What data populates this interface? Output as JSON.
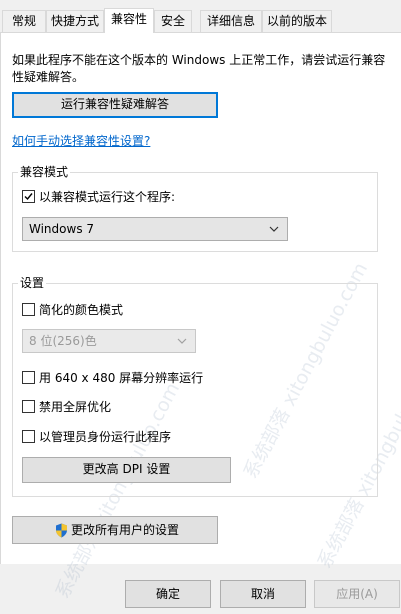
{
  "tabs": [
    "常规",
    "快捷方式",
    "兼容性",
    "安全",
    "详细信息",
    "以前的版本"
  ],
  "intro_text": "如果此程序不能在这个版本的 Windows 上正常工作，请尝试运行兼容性疑难解答。",
  "troubleshooter_button": "运行兼容性疑难解答",
  "manual_link": "如何手动选择兼容性设置?",
  "compat_group": {
    "title": "兼容模式",
    "checkbox_label": "以兼容模式运行这个程序:",
    "checked": true,
    "selected_os": "Windows 7"
  },
  "settings_group": {
    "title": "设置",
    "reduced_color_label": "简化的颜色模式",
    "color_select_value": "8 位(256)色",
    "resolution_label": "用 640 x 480 屏幕分辨率运行",
    "fullscreen_opt_label": "禁用全屏优化",
    "admin_label": "以管理员身份运行此程序",
    "dpi_button": "更改高 DPI 设置"
  },
  "all_users_button": "更改所有用户的设置",
  "footer": {
    "ok": "确定",
    "cancel": "取消",
    "apply": "应用(A)"
  },
  "watermark_text": "系统部落 xitongbuluo.com",
  "colors": {
    "accent": "#0078d7",
    "link": "#0066cc"
  }
}
